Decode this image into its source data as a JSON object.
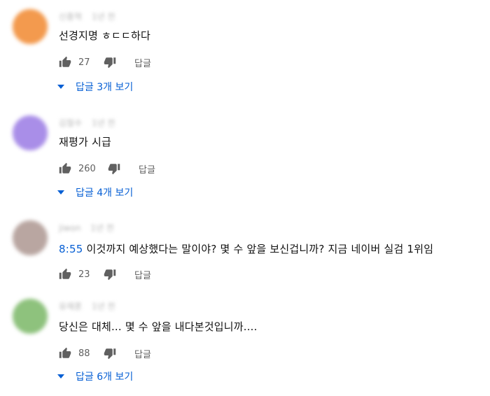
{
  "comments": [
    {
      "avatar_color": "#f39a4e",
      "author": "신종혁",
      "time": "1년 전",
      "text": "선경지명 ㅎㄷㄷ하다",
      "timestamp": "",
      "likes": "27",
      "reply_label": "답글",
      "replies_label": "답글 3개 보기"
    },
    {
      "avatar_color": "#a98ee8",
      "author": "김철수",
      "time": "1년 전",
      "text": "재평가 시급",
      "timestamp": "",
      "likes": "260",
      "reply_label": "답글",
      "replies_label": "답글 4개 보기"
    },
    {
      "avatar_color": "#b9a6a1",
      "author": "jiwon",
      "time": "1년 전",
      "text": "이것까지 예상했다는 말이야? 몇 수 앞을 보신겁니까? 지금 네이버 실검 1위임",
      "timestamp": "8:55",
      "likes": "23",
      "reply_label": "답글",
      "replies_label": ""
    },
    {
      "avatar_color": "#8ec27d",
      "author": "유재훈",
      "time": "1년 전",
      "text": "당신은 대체... 몇 수 앞을 내다본것입니까....",
      "timestamp": "",
      "likes": "88",
      "reply_label": "답글",
      "replies_label": "답글 6개 보기"
    }
  ]
}
